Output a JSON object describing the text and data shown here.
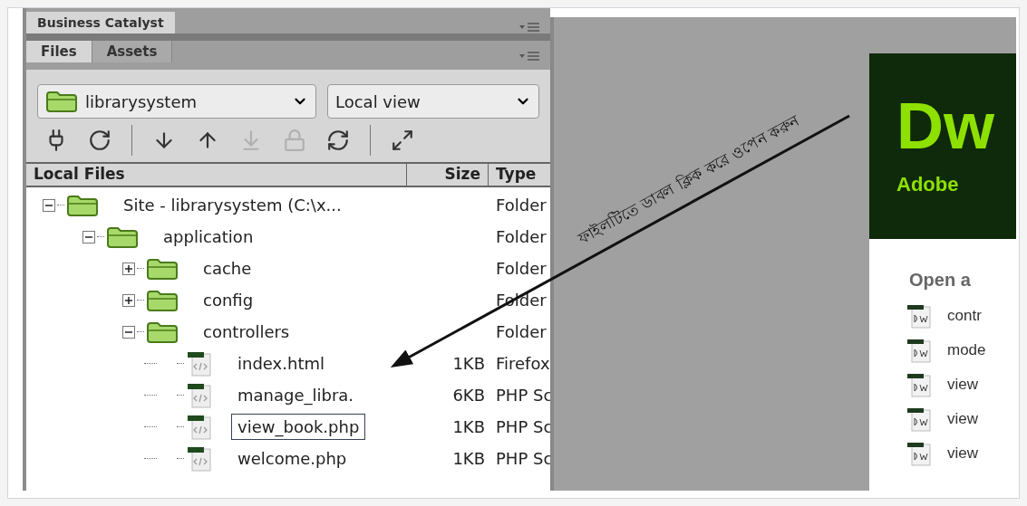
{
  "panel_group": {
    "title": "Business Catalyst"
  },
  "tabs": [
    {
      "label": "Files",
      "selected": true
    },
    {
      "label": "Assets",
      "selected": false
    }
  ],
  "site_select": {
    "value": "librarysystem"
  },
  "view_select": {
    "value": "Local view"
  },
  "toolbar": [
    {
      "disabled": false
    },
    {
      "disabled": false
    },
    {
      "disabled": false
    },
    {
      "disabled": false
    },
    {
      "disabled": true
    },
    {
      "disabled": true
    },
    {
      "disabled": false
    },
    {
      "disabled": false
    }
  ],
  "table": {
    "columns": [
      "Local Files",
      "Size",
      "Type"
    ],
    "rows": [
      {
        "kind": "folder",
        "name": "Site - librarysystem (C:\\x...",
        "type": "Folder",
        "expanded": true,
        "children": [
          {
            "kind": "folder",
            "name": "application",
            "type": "Folder",
            "expanded": true,
            "children": [
              {
                "kind": "folder",
                "name": "cache",
                "type": "Folder",
                "expanded": false
              },
              {
                "kind": "folder",
                "name": "config",
                "type": "Folder",
                "expanded": false
              },
              {
                "kind": "folder",
                "name": "controllers",
                "type": "Folder",
                "expanded": true,
                "children": [
                  {
                    "kind": "file",
                    "name": "index.html",
                    "size": "1KB",
                    "type": "Firefox",
                    "selected": false
                  },
                  {
                    "kind": "file",
                    "name": "manage_libra.",
                    "size": "6KB",
                    "type": "PHP Sc",
                    "selected": false
                  },
                  {
                    "kind": "file",
                    "name": "view_book.php",
                    "size": "1KB",
                    "type": "PHP Sc",
                    "selected": true
                  },
                  {
                    "kind": "file",
                    "name": "welcome.php",
                    "size": "1KB",
                    "type": "PHP Sc",
                    "selected": false
                  }
                ]
              }
            ]
          }
        ]
      }
    ]
  },
  "start_page": {
    "logo": "Dw",
    "brand": "Adobe",
    "heading": "Open a",
    "recent": [
      "contr",
      "mode",
      "view",
      "view",
      "view"
    ]
  },
  "annotation": {
    "text": "ফাইলটিতে ডাবল ক্লিক করে ওপেন করুন"
  }
}
